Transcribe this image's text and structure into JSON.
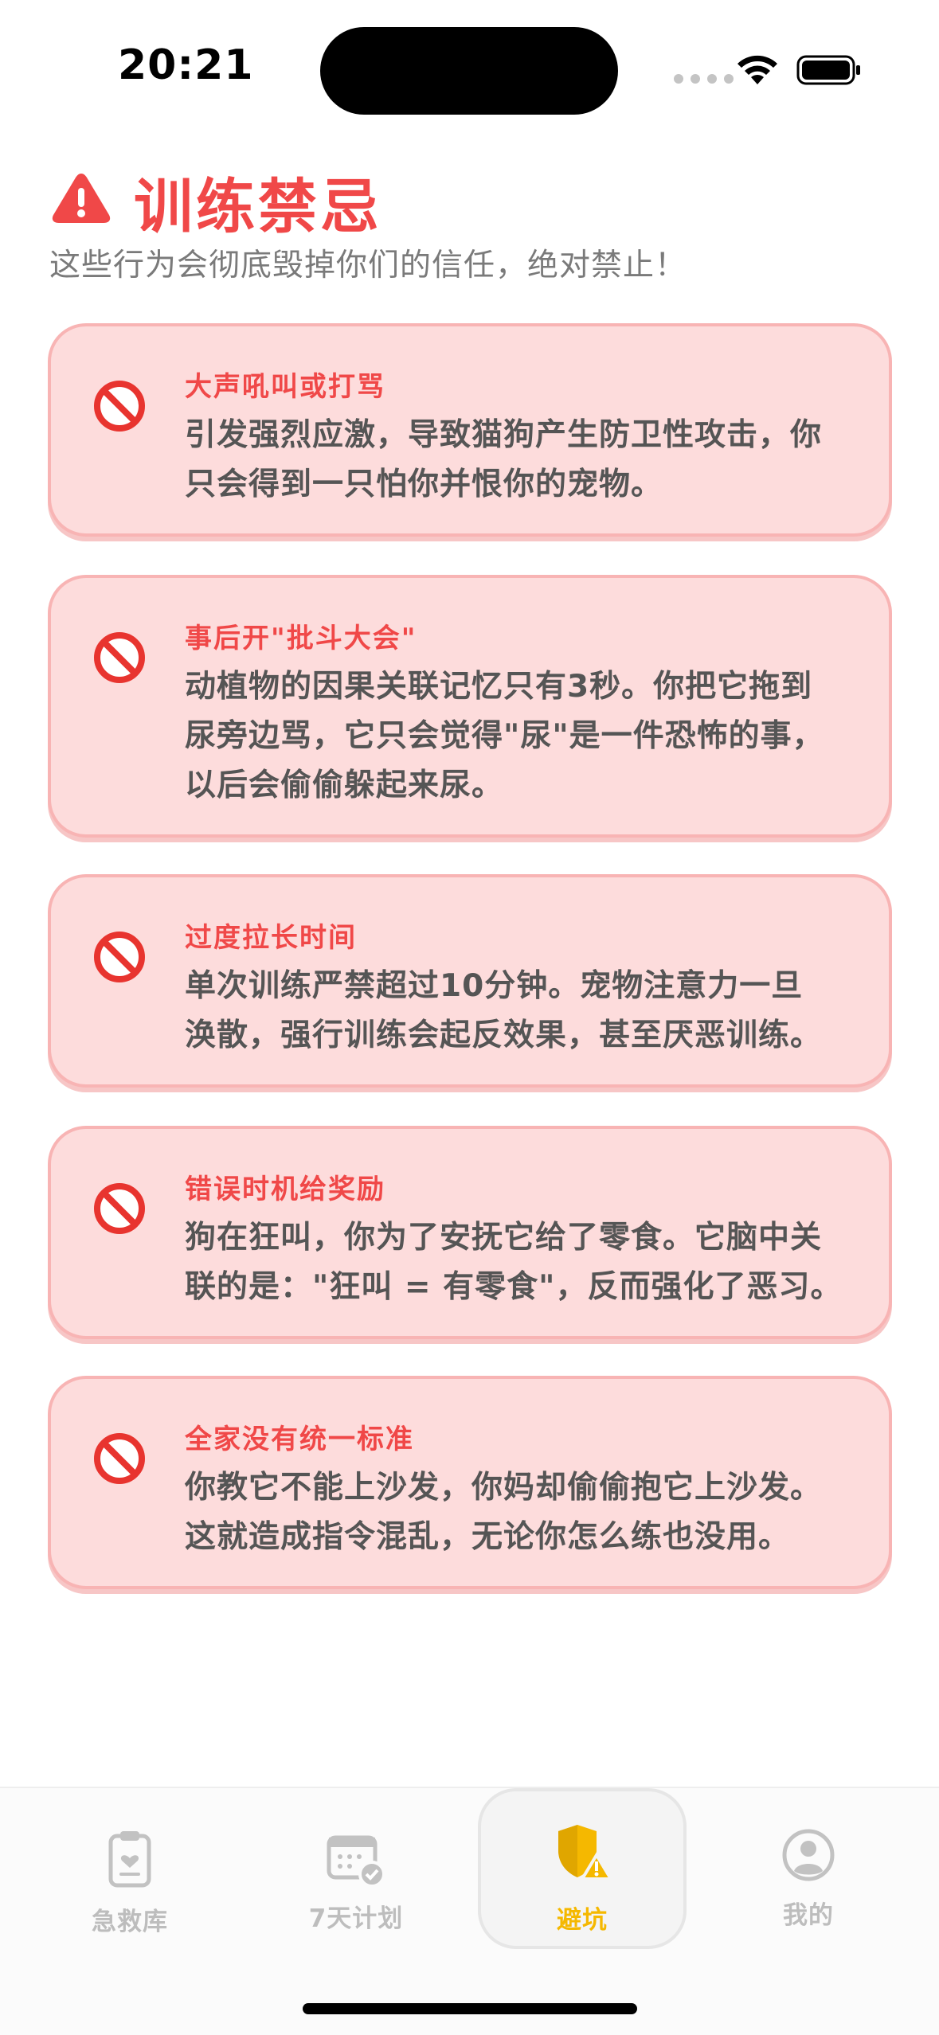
{
  "status_bar": {
    "time": "20:21"
  },
  "header": {
    "title": "训练禁忌",
    "subtitle": "这些行为会彻底毁掉你们的信任，绝对禁止！",
    "icon": "warning-triangle-icon"
  },
  "taboos": [
    {
      "icon": "prohibited-icon",
      "title": "大声吼叫或打骂",
      "lines": [
        "引发强烈应激，导致猫狗产生防卫性攻击，你",
        "只会得到一只怕你并恨你的宠物。"
      ]
    },
    {
      "icon": "prohibited-icon",
      "title": "事后开\"批斗大会\"",
      "lines": [
        "动植物的因果关联记忆只有3秒。你把它拖到",
        "尿旁边骂，它只会觉得\"尿\"是一件恐怖的事，",
        "以后会偷偷躲起来尿。"
      ]
    },
    {
      "icon": "prohibited-icon",
      "title": "过度拉长时间",
      "lines": [
        "单次训练严禁超过10分钟。宠物注意力一旦",
        "涣散，强行训练会起反效果，甚至厌恶训练。"
      ]
    },
    {
      "icon": "prohibited-icon",
      "title": "错误时机给奖励",
      "lines": [
        "狗在狂叫，你为了安抚它给了零食。它脑中关",
        "联的是：\"狂叫 = 有零食\"，反而强化了恶习。"
      ]
    },
    {
      "icon": "prohibited-icon",
      "title": "全家没有统一标准",
      "lines": [
        "你教它不能上沙发，你妈却偷偷抱它上沙发。",
        "这就造成指令混乱，无论你怎么练也没用。"
      ]
    }
  ],
  "tabbar": {
    "tabs": [
      {
        "label": "急救库",
        "icon": "clipboard-heart-icon",
        "active": false
      },
      {
        "label": "7天计划",
        "icon": "calendar-check-icon",
        "active": false
      },
      {
        "label": "避坑",
        "icon": "shield-warning-icon",
        "active": true
      },
      {
        "label": "我的",
        "icon": "person-circle-icon",
        "active": false
      }
    ]
  },
  "colors": {
    "accent_red": "#f04848",
    "card_bg": "#fddcdc",
    "card_border": "#f8b4b4",
    "active_tab": "#f5b800",
    "inactive_tab": "#bdbdbd"
  }
}
